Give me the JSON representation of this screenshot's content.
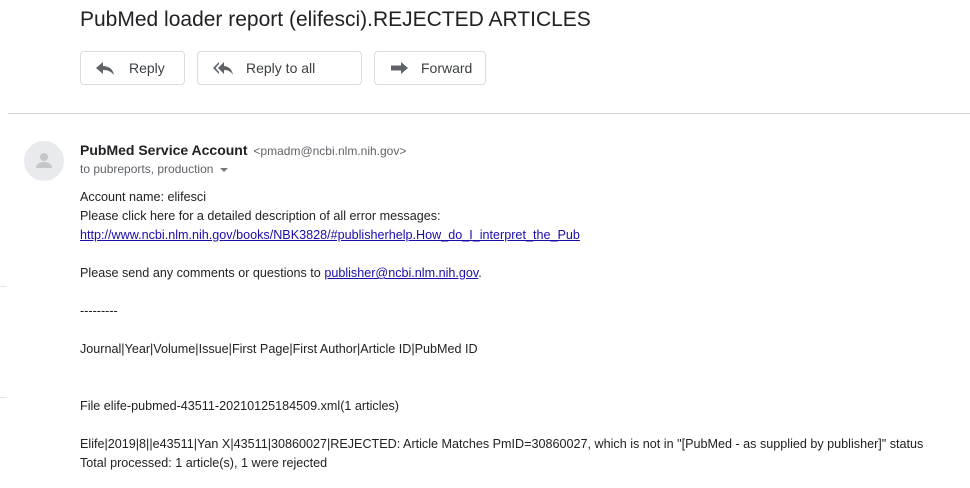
{
  "email": {
    "subject": "PubMed loader report (elifesci).REJECTED ARTICLES",
    "actions": {
      "reply": "Reply",
      "reply_all": "Reply to all",
      "forward": "Forward"
    },
    "sender": {
      "name": "PubMed Service Account",
      "email": "<pmadm@ncbi.nlm.nih.gov>",
      "to": "to pubreports, production"
    },
    "body": {
      "account": "Account name: elifesci",
      "click_here": "Please click here for a detailed description of all error messages:",
      "help_link": "http://www.ncbi.nlm.nih.gov/books/NBK3828/#publisherhelp.How_do_I_interpret_the_Pub",
      "comments_prefix": "Please send any comments or questions to ",
      "comments_link": "publisher@ncbi.nlm.nih.gov",
      "comments_suffix": ".",
      "separator": "---------",
      "header_row": "Journal|Year|Volume|Issue|First Page|First Author|Article ID|PubMed ID",
      "file_line": "File elife-pubmed-43511-20210125184509.xml(1 articles)",
      "record": "Elife|2019|8||e43511|Yan X|43511|30860027|REJECTED: Article Matches PmID=30860027, which is not in \"[PubMed - as supplied by publisher]\" status",
      "total": "Total processed: 1 article(s), 1 were rejected"
    }
  },
  "colors": {
    "link": "#1a0dab",
    "divider": "#d5d5d5",
    "button_border": "#dadce0",
    "avatar_bg": "#e8eaed"
  }
}
